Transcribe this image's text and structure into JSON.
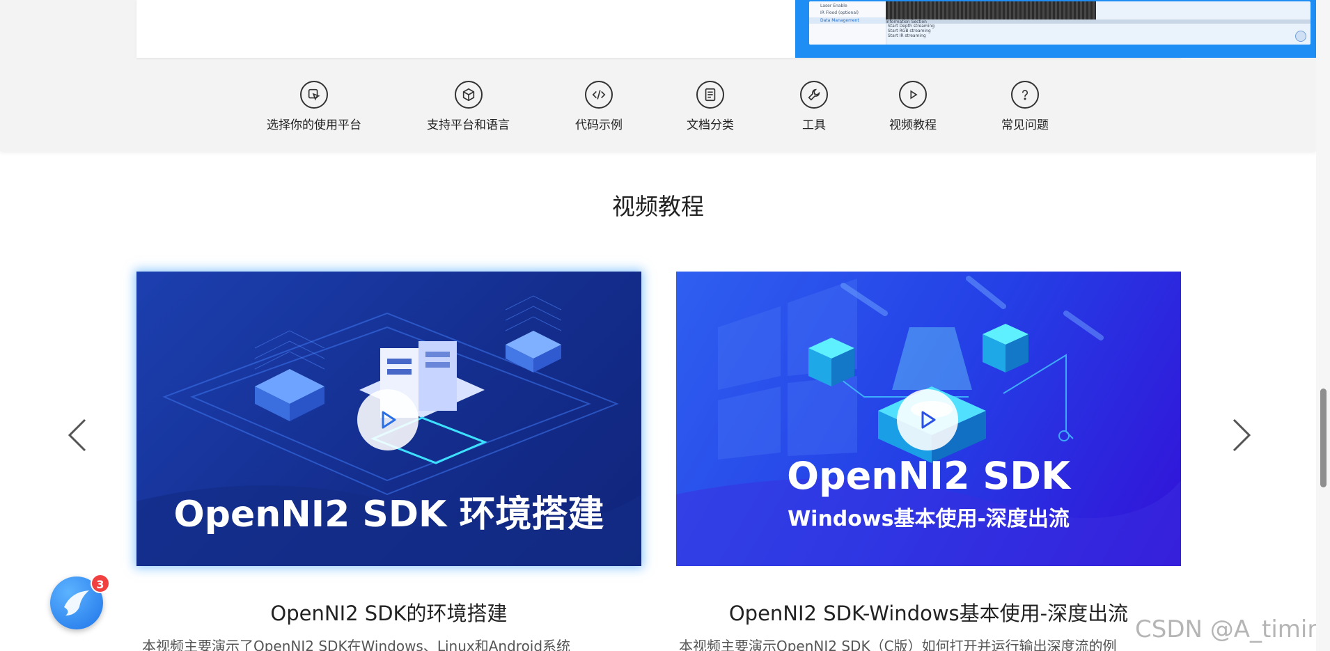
{
  "screenshot_preview": {
    "menu_items": [
      "Laser Enable",
      "IR Flood (optional)"
    ],
    "active_item": "Data Management",
    "info_lines": [
      "Information Section",
      "Start Depth streaming",
      "Start RGB streaming",
      "Start IR streaming"
    ]
  },
  "nav": {
    "items": [
      {
        "label": "选择你的使用平台",
        "icon": "cursor-click-icon"
      },
      {
        "label": "支持平台和语言",
        "icon": "box-icon"
      },
      {
        "label": "代码示例",
        "icon": "code-icon"
      },
      {
        "label": "文档分类",
        "icon": "document-icon"
      },
      {
        "label": "工具",
        "icon": "wrench-icon"
      },
      {
        "label": "视频教程",
        "icon": "play-circle-icon"
      },
      {
        "label": "常见问题",
        "icon": "question-icon"
      }
    ]
  },
  "section": {
    "title": "视频教程"
  },
  "videos": [
    {
      "thumbnail_text": "OpenNI2 SDK 环境搭建",
      "title": "OpenNI2 SDK的环境搭建",
      "description": "本视频主要演示了OpenNI2 SDK在Windows、Linux和Android系统"
    },
    {
      "thumbnail_text": "OpenNI2 SDK",
      "thumbnail_subtext": "Windows基本使用-深度出流",
      "title": "OpenNI2 SDK-Windows基本使用-深度出流",
      "description": "本视频主要演示OpenNI2 SDK（C版）如何打开并运行输出深度流的例"
    }
  ],
  "float_button": {
    "badge_count": "3"
  },
  "watermark": "CSDN @A_timing",
  "colors": {
    "accent": "#1e8ef5",
    "card1_bg": "#142e8e",
    "card2_bg": "#2a2ae0",
    "badge": "#f04040"
  }
}
